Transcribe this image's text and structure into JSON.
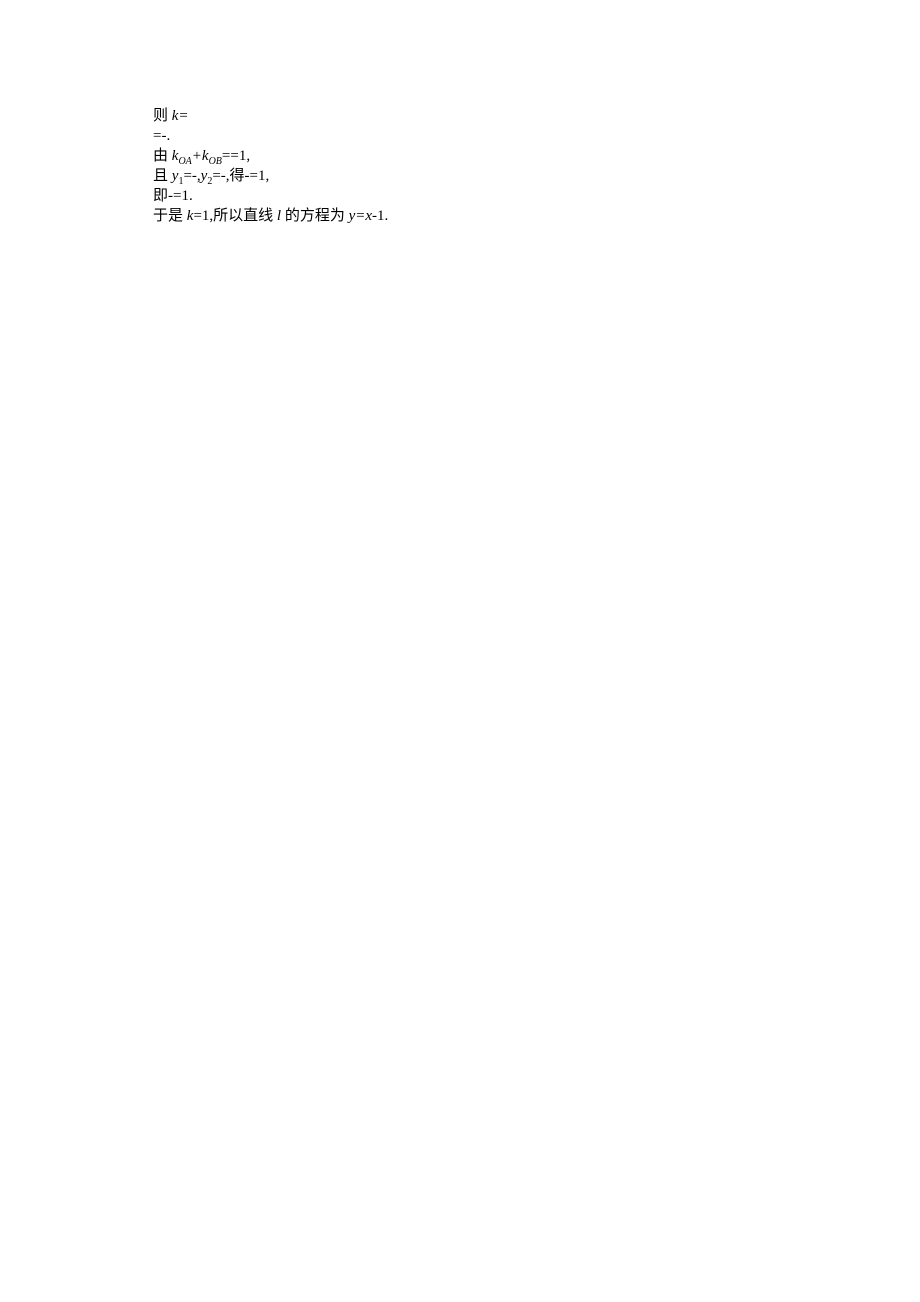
{
  "lines": [
    {
      "segments": [
        {
          "t": "则 "
        },
        {
          "t": "k=",
          "it": true
        }
      ]
    },
    {
      "segments": [
        {
          "t": "=-."
        }
      ]
    },
    {
      "segments": [
        {
          "t": "由 "
        },
        {
          "t": "k",
          "it": true
        },
        {
          "t": "OA",
          "sub": true,
          "subIt": true
        },
        {
          "t": "+",
          "it": true
        },
        {
          "t": "k",
          "it": true
        },
        {
          "t": "OB",
          "sub": true,
          "subIt": true
        },
        {
          "t": "=="
        },
        {
          "t": "1,"
        }
      ]
    },
    {
      "segments": [
        {
          "t": "且 "
        },
        {
          "t": "y",
          "it": true
        },
        {
          "t": "1",
          "sub": true
        },
        {
          "t": "=-"
        },
        {
          "t": ","
        },
        {
          "t": "y",
          "it": true
        },
        {
          "t": "2",
          "sub": true
        },
        {
          "t": "=-"
        },
        {
          "t": ",得-=1,"
        }
      ]
    },
    {
      "segments": [
        {
          "t": "即-=1."
        }
      ]
    },
    {
      "segments": [
        {
          "t": "于是 "
        },
        {
          "t": "k",
          "it": true
        },
        {
          "t": "=1,所以直线 "
        },
        {
          "t": "l",
          "it": true
        },
        {
          "t": " 的方程为 "
        },
        {
          "t": "y=x",
          "it": true
        },
        {
          "t": "-1."
        }
      ]
    }
  ]
}
